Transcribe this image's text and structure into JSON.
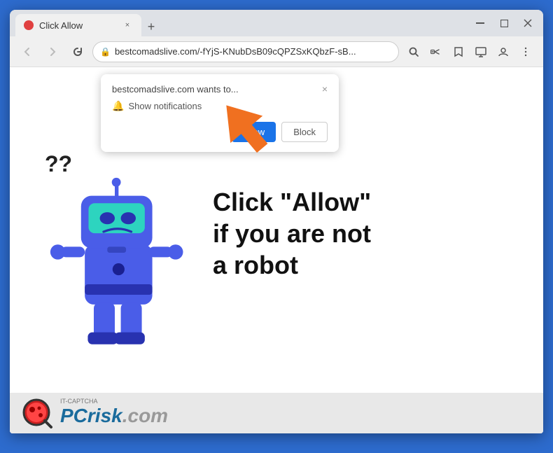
{
  "window": {
    "title": "Click Allow",
    "tab_close": "×",
    "new_tab": "+",
    "controls": {
      "minimize": "—",
      "maximize": "□",
      "close": "×"
    }
  },
  "address_bar": {
    "url": "bestcomadslive.com/-fYjS-KNubDsB09cQPZSxKQbzF-sB...",
    "lock_icon": "🔒"
  },
  "notification_popup": {
    "title": "bestcomadslive.com wants to...",
    "close": "×",
    "show_notifications_label": "Show notifications",
    "allow_label": "Allow",
    "block_label": "Block"
  },
  "page": {
    "question_marks": "??",
    "main_text": "Click \"Allow\"\nif you are not\na robot"
  },
  "footer": {
    "captcha_label": "IT-CAPTCHA",
    "brand_name": "PCrisk",
    "brand_suffix": ".com"
  },
  "colors": {
    "background": "#2d6bcd",
    "allow_btn": "#1a73e8",
    "robot_body": "#4a5de8",
    "robot_dark": "#2832b0",
    "robot_visor": "#2dd4bf",
    "arrow_color": "#f07020"
  }
}
